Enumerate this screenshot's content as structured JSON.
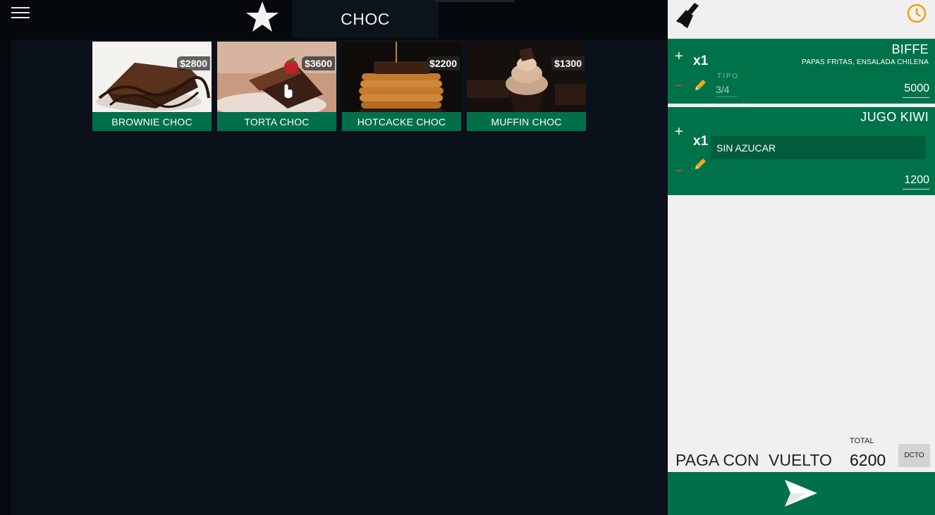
{
  "header": {
    "category_title": "CHOC",
    "icons": {
      "menu": "hamburger-icon",
      "favorites": "star-icon"
    }
  },
  "products": [
    {
      "name": "BROWNIE CHOC",
      "price": "$2800"
    },
    {
      "name": "TORTA CHOC",
      "price": "$3600"
    },
    {
      "name": "HOTCACKE CHOC",
      "price": "$2200"
    },
    {
      "name": "MUFFIN CHOC",
      "price": "$1300"
    }
  ],
  "order": {
    "items": [
      {
        "title": "BIFFE",
        "subtitle": "PAPAS FRITAS, ENSALADA CHILENA",
        "qty": "x1",
        "tipo_label": "TIPO",
        "tipo_value": "3/4",
        "price": "5000",
        "plus": "+",
        "minus": "−"
      },
      {
        "title": "JUGO KIWI",
        "note": "SIN AZUCAR",
        "qty": "x1",
        "price": "1200",
        "plus": "+",
        "minus": "−"
      }
    ]
  },
  "footer": {
    "paga_con": "PAGA CON",
    "vuelto": "VUELTO",
    "total_label": "TOTAL",
    "total_value": "6200",
    "dcto": "DCTO"
  },
  "colors": {
    "accent_green": "#00704a",
    "clock_orange": "#f39c12",
    "minus_red": "#d9472f",
    "pencil_yellow": "#f2a71b"
  }
}
